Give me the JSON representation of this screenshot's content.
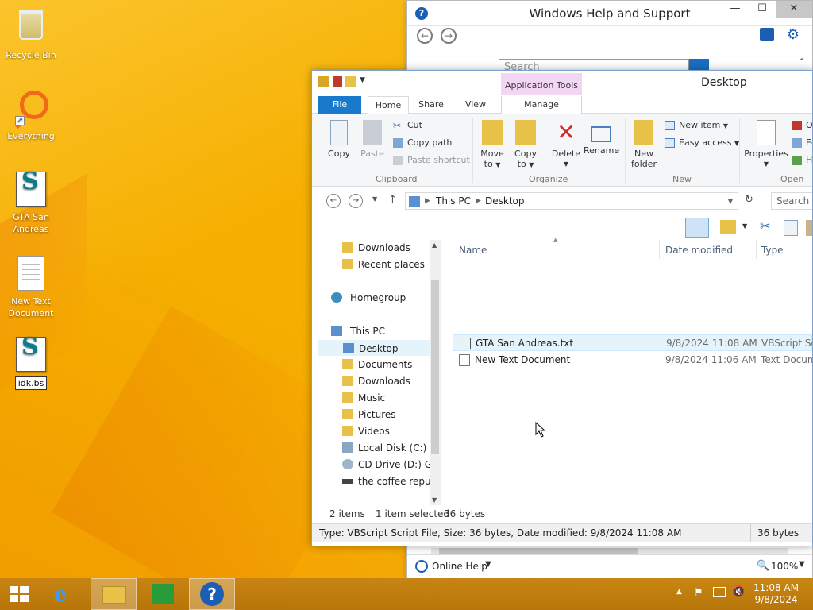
{
  "desktop": {
    "icons": [
      {
        "label": "Recycle Bin"
      },
      {
        "label": "Everything"
      },
      {
        "label": "GTA San Andreas"
      },
      {
        "label": "New Text Document"
      },
      {
        "label": "idk.bs"
      }
    ]
  },
  "help_window": {
    "title": "Windows Help and Support",
    "search_placeholder": "Search",
    "online_help": "Online Help",
    "zoom": "100%"
  },
  "explorer": {
    "title": "Desktop",
    "context_tab": "Application Tools",
    "tabs": [
      "File",
      "Home",
      "Share",
      "View",
      "Manage"
    ],
    "ribbon": {
      "clipboard": {
        "label": "Clipboard",
        "copy": "Copy",
        "paste": "Paste",
        "cut": "Cut",
        "copy_path": "Copy path",
        "paste_shortcut": "Paste shortcut"
      },
      "organize": {
        "label": "Organize",
        "move_to_1": "Move",
        "move_to_2": "to",
        "copy_to_1": "Copy",
        "copy_to_2": "to",
        "delete": "Delete",
        "rename": "Rename"
      },
      "new": {
        "label": "New",
        "new_folder_1": "New",
        "new_folder_2": "folder",
        "new_item": "New item",
        "easy_access": "Easy access"
      },
      "open": {
        "label": "Open",
        "properties": "Properties",
        "open_item": "O",
        "edit": "Ed",
        "history": "H"
      }
    },
    "address": {
      "this_pc": "This PC",
      "desktop": "Desktop",
      "search_placeholder": "Search De"
    },
    "nav": [
      {
        "label": "Downloads"
      },
      {
        "label": "Recent places"
      },
      {
        "label": "Homegroup"
      },
      {
        "label": "This PC"
      },
      {
        "label": "Desktop"
      },
      {
        "label": "Documents"
      },
      {
        "label": "Downloads"
      },
      {
        "label": "Music"
      },
      {
        "label": "Pictures"
      },
      {
        "label": "Videos"
      },
      {
        "label": "Local Disk (C:)"
      },
      {
        "label": "CD Drive (D:) GSP"
      },
      {
        "label": "the coffee republ"
      }
    ],
    "columns": [
      "Name",
      "Date modified",
      "Type"
    ],
    "files": [
      {
        "name": "GTA San Andreas.txt",
        "date": "9/8/2024 11:08 AM",
        "type": "VBScript Scri"
      },
      {
        "name": "New Text Document",
        "date": "9/8/2024 11:06 AM",
        "type": "Text Docume"
      }
    ],
    "status": {
      "items": "2 items",
      "selected": "1 item selected",
      "size": "36 bytes"
    },
    "detail": {
      "text": "Type: VBScript Script File, Size: 36 bytes, Date modified: 9/8/2024 11:08 AM",
      "size": "36 bytes"
    }
  },
  "taskbar": {
    "time": "11:08 AM",
    "date": "9/8/2024"
  }
}
